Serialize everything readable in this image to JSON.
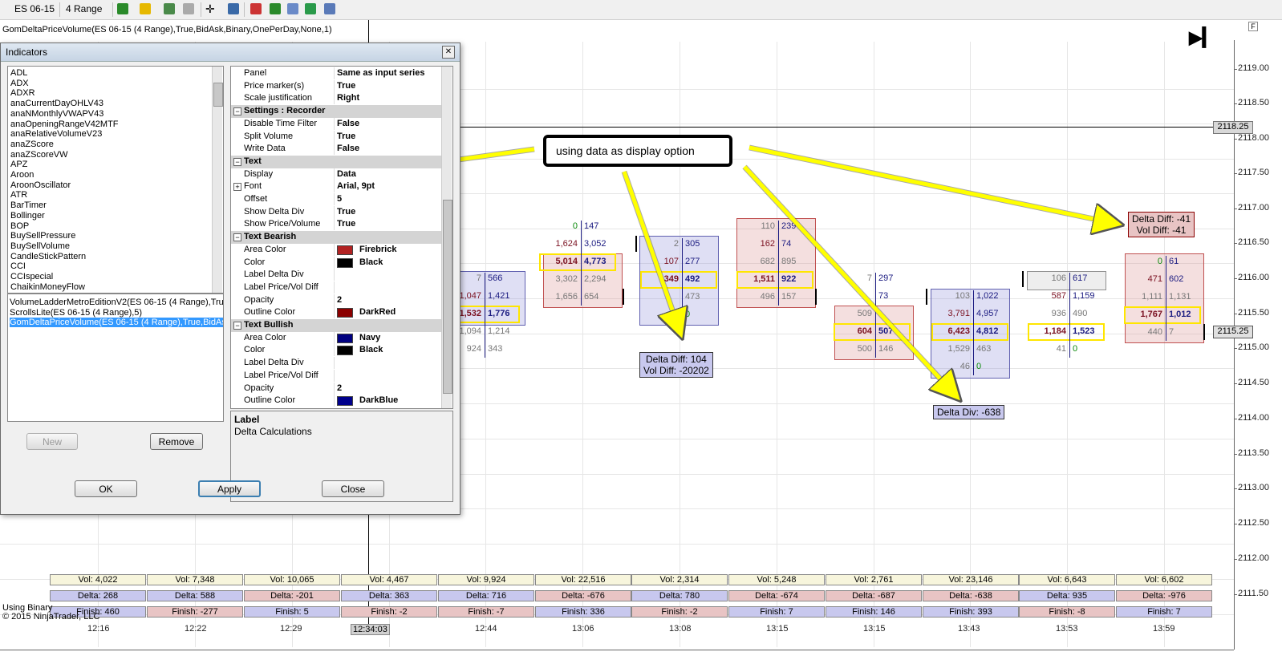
{
  "toolbar": {
    "instrument": "ES 06-15",
    "period": "4 Range"
  },
  "chart": {
    "indicator_label": "GomDeltaPriceVolume(ES 06-15 (4 Range),True,BidAsk,Binary,OnePerDay,None,1)",
    "bottom_left_1": "Using Binary",
    "bottom_left_2": "© 2015 NinjaTrader, LLC",
    "crosshair_time": "12:34:03",
    "crosshair_price": "2118.25",
    "last_price": "2115.25",
    "price_labels": [
      "2119.00",
      "2118.50",
      "2118.00",
      "2117.50",
      "2117.00",
      "2116.50",
      "2116.00",
      "2115.50",
      "2115.00",
      "2114.50",
      "2114.00",
      "2113.50",
      "2113.00",
      "2112.50",
      "2112.00",
      "2111.50"
    ],
    "time_labels": [
      "12:16",
      "12:22",
      "12:29",
      "34",
      "12:44",
      "13:06",
      "13:08",
      "13:15",
      "13:15",
      "13:43",
      "13:53",
      "13:59"
    ],
    "callout_text": "using data as display option",
    "delta_labels": [
      {
        "line1": "Delta Diff: 104",
        "line2": "Vol Diff: -20202"
      },
      {
        "line1": "Delta Div: -638",
        "line2": ""
      },
      {
        "line1": "Delta Diff: -41",
        "line2": "Vol Diff: -41"
      }
    ],
    "stats": {
      "vol": [
        "Vol:  4,022",
        "Vol:  7,348",
        "Vol:  10,065",
        "Vol:  4,467",
        "Vol:  9,924",
        "Vol:  22,516",
        "Vol:  2,314",
        "Vol:  5,248",
        "Vol:  2,761",
        "Vol:  23,146",
        "Vol:  6,643",
        "Vol:  6,602"
      ],
      "delta": [
        "Delta:  268",
        "Delta:  588",
        "Delta:  -201",
        "Delta:  363",
        "Delta:  716",
        "Delta:  -676",
        "Delta:  780",
        "Delta:  -674",
        "Delta:  -687",
        "Delta:  -638",
        "Delta:  935",
        "Delta:  -976"
      ],
      "finish": [
        "Finish:  460",
        "Finish:  -277",
        "Finish:  5",
        "Finish:  -2",
        "Finish:  -7",
        "Finish:  336",
        "Finish:  -2",
        "Finish:  7",
        "Finish:  146",
        "Finish:  393",
        "Finish:  -8",
        "Finish:  7"
      ]
    },
    "clusters": [
      {
        "rows": [
          [
            "7",
            "566"
          ],
          [
            "1,047",
            "1,421"
          ],
          [
            "1,532",
            "1,776"
          ],
          [
            "1,094",
            "1,214"
          ],
          [
            "924",
            "343"
          ]
        ]
      },
      {
        "rows": [
          [
            "0",
            "147"
          ],
          [
            "1,624",
            "3,052"
          ],
          [
            "5,014",
            "4,773"
          ],
          [
            "3,302",
            "2,294"
          ],
          [
            "1,656",
            "654"
          ]
        ]
      },
      {
        "rows": [
          [
            "2",
            "305"
          ],
          [
            "107",
            "277"
          ],
          [
            "349",
            "492"
          ],
          [
            "",
            "473"
          ],
          [
            "",
            "0"
          ]
        ]
      },
      {
        "rows": [
          [
            "110",
            "239"
          ],
          [
            "162",
            "74"
          ],
          [
            "682",
            "895"
          ],
          [
            "1,511",
            "922"
          ],
          [
            "496",
            "157"
          ]
        ]
      },
      {
        "rows": [
          [
            "7",
            "297"
          ],
          [
            "",
            "73"
          ],
          [
            "509",
            ""
          ],
          [
            "604",
            "507"
          ],
          [
            "500",
            "146"
          ]
        ]
      },
      {
        "rows": [
          [
            "103",
            "1,022"
          ],
          [
            "3,791",
            "4,957"
          ],
          [
            "6,423",
            "4,812"
          ],
          [
            "1,529",
            "463"
          ],
          [
            "46",
            "0"
          ]
        ]
      },
      {
        "rows": [
          [
            "106",
            "617"
          ],
          [
            "587",
            "1,159"
          ],
          [
            "936",
            "490"
          ],
          [
            "1,184",
            "1,523"
          ],
          [
            "41",
            "0"
          ]
        ]
      },
      {
        "rows": [
          [
            "0",
            "61"
          ],
          [
            "471",
            "602"
          ],
          [
            "1,111",
            "1,131"
          ],
          [
            "1,767",
            "1,012"
          ],
          [
            "440",
            "7"
          ]
        ]
      }
    ]
  },
  "dialog": {
    "title": "Indicators",
    "indicators": [
      "ADL",
      "ADX",
      "ADXR",
      "anaCurrentDayOHLV43",
      "anaNMonthlyVWAPV43",
      "anaOpeningRangeV42MTF",
      "anaRelativeVolumeV23",
      "anaZScore",
      "anaZScoreVW",
      "APZ",
      "Aroon",
      "AroonOscillator",
      "ATR",
      "BarTimer",
      "Bollinger",
      "BOP",
      "BuySellPressure",
      "BuySellVolume",
      "CandleStickPattern",
      "CCI",
      "CCIspecial",
      "ChaikinMoneyFlow"
    ],
    "applied": [
      "VolumeLadderMetroEditionV2(ES 06-15 (4 Range),True,E",
      "ScrollsLite(ES 06-15 (4 Range),5)",
      "GomDeltaPriceVolume(ES 06-15 (4 Range),True,BidAsk,"
    ],
    "properties": [
      {
        "type": "prop",
        "name": "Panel",
        "value": "Same as input series"
      },
      {
        "type": "prop",
        "name": "Price marker(s)",
        "value": "True"
      },
      {
        "type": "prop",
        "name": "Scale justification",
        "value": "Right"
      },
      {
        "type": "cat",
        "name": "Settings : Recorder"
      },
      {
        "type": "prop",
        "name": "Disable Time Filter",
        "value": "False"
      },
      {
        "type": "prop",
        "name": "Split Volume",
        "value": "True"
      },
      {
        "type": "prop",
        "name": "Write Data",
        "value": "False"
      },
      {
        "type": "cat",
        "name": "Text"
      },
      {
        "type": "prop",
        "name": "Display",
        "value": "Data"
      },
      {
        "type": "propx",
        "name": "Font",
        "value": "Arial, 9pt"
      },
      {
        "type": "prop",
        "name": "Offset",
        "value": "5"
      },
      {
        "type": "prop",
        "name": "Show Delta Div",
        "value": "True"
      },
      {
        "type": "prop",
        "name": "Show Price/Volume",
        "value": "True"
      },
      {
        "type": "cat",
        "name": "Text Bearish"
      },
      {
        "type": "color",
        "name": "Area Color",
        "value": "Firebrick",
        "color": "#b22222"
      },
      {
        "type": "color",
        "name": "Color",
        "value": "Black",
        "color": "#000000"
      },
      {
        "type": "prop",
        "name": "Label Delta Div",
        "value": ""
      },
      {
        "type": "prop",
        "name": "Label Price/Vol Diff",
        "value": ""
      },
      {
        "type": "prop",
        "name": "Opacity",
        "value": "2"
      },
      {
        "type": "color",
        "name": "Outline Color",
        "value": "DarkRed",
        "color": "#8b0000"
      },
      {
        "type": "cat",
        "name": "Text Bullish"
      },
      {
        "type": "color",
        "name": "Area Color",
        "value": "Navy",
        "color": "#000080"
      },
      {
        "type": "color",
        "name": "Color",
        "value": "Black",
        "color": "#000000"
      },
      {
        "type": "prop",
        "name": "Label Delta Div",
        "value": ""
      },
      {
        "type": "prop",
        "name": "Label Price/Vol Diff",
        "value": ""
      },
      {
        "type": "prop",
        "name": "Opacity",
        "value": "2"
      },
      {
        "type": "color",
        "name": "Outline Color",
        "value": "DarkBlue",
        "color": "#00008b"
      }
    ],
    "help_title": "Label",
    "help_text": "Delta Calculations",
    "buttons": {
      "new": "New",
      "remove": "Remove",
      "ok": "OK",
      "apply": "Apply",
      "close": "Close"
    }
  }
}
